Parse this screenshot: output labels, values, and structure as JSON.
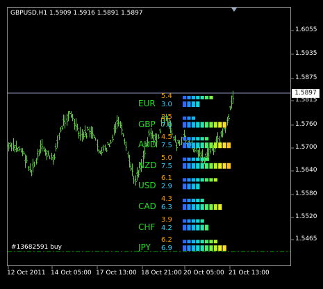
{
  "chart_window": {
    "title": "GBPUSD,H1  1.5909 1.5916 1.5891 1.5897",
    "current_price": "1.5897",
    "price_scale": [
      "1.6055",
      "1.5935",
      "1.5875",
      "1.5815",
      "1.5760",
      "1.5700",
      "1.5640",
      "1.5580",
      "1.5520",
      "1.5465"
    ],
    "time_scale": [
      "12 Oct 2011",
      "14 Oct 05:00",
      "17 Oct 13:00",
      "18 Oct 21:00",
      "20 Oct 05:00",
      "21 Oct 13:00"
    ],
    "order_label": "#13682591 buy"
  },
  "strength_meter": {
    "colors": {
      "currency_label": "#22dd22",
      "top_value": "#ff9900",
      "bottom_value": "#33ccff",
      "chart_line": "#55cc33",
      "price_line": "#8899bb"
    },
    "currencies": [
      {
        "name": "EUR",
        "top": "5.4",
        "bottom": "3.0"
      },
      {
        "name": "GBP",
        "top": "2.5",
        "bottom": "7.0"
      },
      {
        "name": "AUD",
        "top": "4.5",
        "bottom": "7.5"
      },
      {
        "name": "NZD",
        "top": "5.0",
        "bottom": "7.5"
      },
      {
        "name": "USD",
        "top": "6.1",
        "bottom": "2.9"
      },
      {
        "name": "CAD",
        "top": "4.3",
        "bottom": "6.3"
      },
      {
        "name": "CHF",
        "top": "3.9",
        "bottom": "4.2"
      },
      {
        "name": "JPY",
        "top": "6.2",
        "bottom": "6.9"
      }
    ]
  }
}
